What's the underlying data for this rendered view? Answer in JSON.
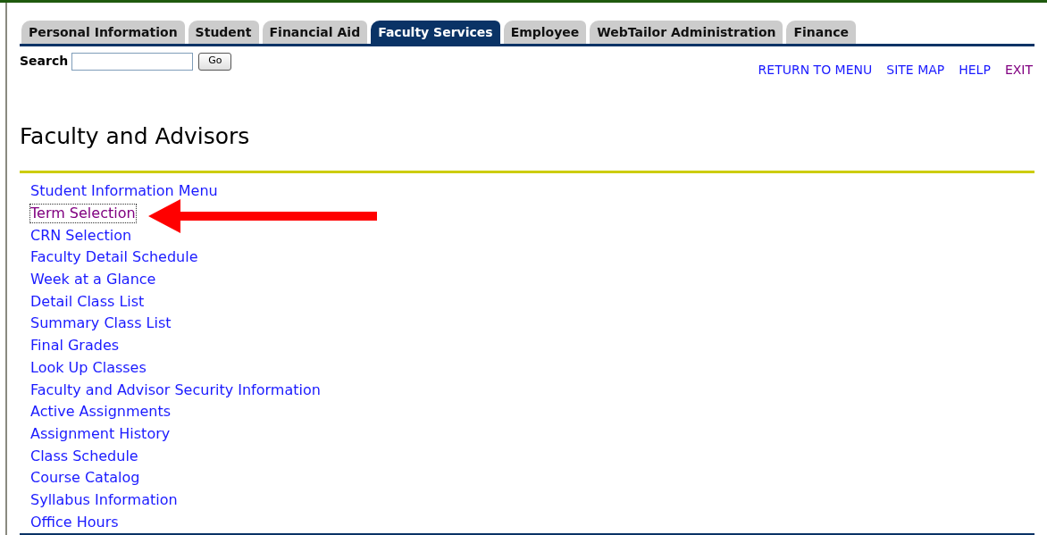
{
  "tabs": [
    {
      "label": "Personal Information",
      "selected": false
    },
    {
      "label": "Student",
      "selected": false
    },
    {
      "label": "Financial Aid",
      "selected": false
    },
    {
      "label": "Faculty Services",
      "selected": true
    },
    {
      "label": "Employee",
      "selected": false
    },
    {
      "label": "WebTailor Administration",
      "selected": false
    },
    {
      "label": "Finance",
      "selected": false
    }
  ],
  "search": {
    "label": "Search",
    "button": "Go"
  },
  "nav_links": [
    {
      "label": "RETURN TO MENU",
      "visited": false
    },
    {
      "label": "SITE MAP",
      "visited": false
    },
    {
      "label": "HELP",
      "visited": false
    },
    {
      "label": "EXIT",
      "visited": true
    }
  ],
  "page_title": "Faculty and Advisors",
  "menu_links": [
    {
      "label": "Student Information Menu",
      "visited": false,
      "focused": false
    },
    {
      "label": "Term Selection",
      "visited": true,
      "focused": true
    },
    {
      "label": "CRN Selection",
      "visited": false,
      "focused": false
    },
    {
      "label": "Faculty Detail Schedule",
      "visited": false,
      "focused": false
    },
    {
      "label": "Week at a Glance",
      "visited": false,
      "focused": false
    },
    {
      "label": "Detail Class List",
      "visited": false,
      "focused": false
    },
    {
      "label": "Summary Class List",
      "visited": false,
      "focused": false
    },
    {
      "label": "Final Grades",
      "visited": false,
      "focused": false
    },
    {
      "label": "Look Up Classes",
      "visited": false,
      "focused": false
    },
    {
      "label": "Faculty and Advisor Security Information",
      "visited": false,
      "focused": false
    },
    {
      "label": "Active Assignments",
      "visited": false,
      "focused": false
    },
    {
      "label": "Assignment History",
      "visited": false,
      "focused": false
    },
    {
      "label": "Class Schedule",
      "visited": false,
      "focused": false
    },
    {
      "label": "Course Catalog",
      "visited": false,
      "focused": false
    },
    {
      "label": "Syllabus Information",
      "visited": false,
      "focused": false
    },
    {
      "label": "Office Hours",
      "visited": false,
      "focused": false
    }
  ]
}
